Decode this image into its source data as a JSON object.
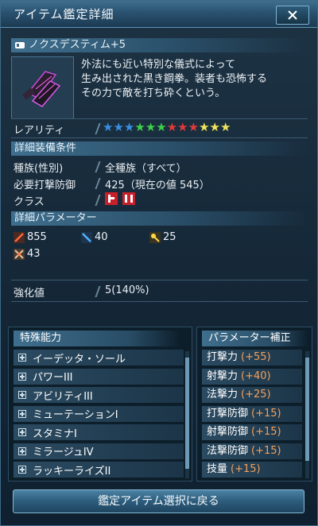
{
  "window": {
    "title": "アイテム鑑定詳細"
  },
  "item": {
    "name": "ノクスデスティム+5",
    "description_lines": [
      "外法にも近い特別な儀式によって",
      "生み出された黒き鋼拳。装者も恐怖する",
      "その力で敵を打ち砕くという。"
    ]
  },
  "rarity": {
    "label": "レアリティ",
    "stars": [
      "#3a8fe0",
      "#3a8fe0",
      "#3a8fe0",
      "#3fd04a",
      "#3fd04a",
      "#3fd04a",
      "#e23a3a",
      "#e23a3a",
      "#e23a3a",
      "#f2e45c",
      "#f2e45c",
      "#f2e45c"
    ]
  },
  "equip_conditions": {
    "header": "詳細装備条件",
    "race_label": "種族(性別)",
    "race_value": "全種族（すべて）",
    "req_label": "必要打撃防御",
    "req_value": "425（現在の値 545）",
    "class_label": "クラス"
  },
  "parameters": {
    "header": "詳細パラメーター",
    "attack": "855",
    "range": "40",
    "tech": "25",
    "other": "43"
  },
  "enhancement": {
    "label": "強化値",
    "value": "5(140%)"
  },
  "abilities": {
    "header": "特殊能力",
    "items": [
      "イーデッタ・ソール",
      "パワーIII",
      "アビリティIII",
      "ミューテーションI",
      "スタミナI",
      "ミラージュIV",
      "ラッキーライズII"
    ]
  },
  "param_bonus": {
    "header": "パラメーター補正",
    "items": [
      {
        "name": "打撃力",
        "value": "(+55)"
      },
      {
        "name": "射撃力",
        "value": "(+40)"
      },
      {
        "name": "法撃力",
        "value": "(+25)"
      },
      {
        "name": "打撃防御",
        "value": "(+15)"
      },
      {
        "name": "射撃防御",
        "value": "(+15)"
      },
      {
        "name": "法撃防御",
        "value": "(+15)"
      },
      {
        "name": "技量",
        "value": "(+15)"
      }
    ]
  },
  "footer": {
    "back_label": "鑑定アイテム選択に戻る"
  },
  "colors": {
    "bonus": "#f4a05a",
    "accent": "#3f6f8e"
  }
}
